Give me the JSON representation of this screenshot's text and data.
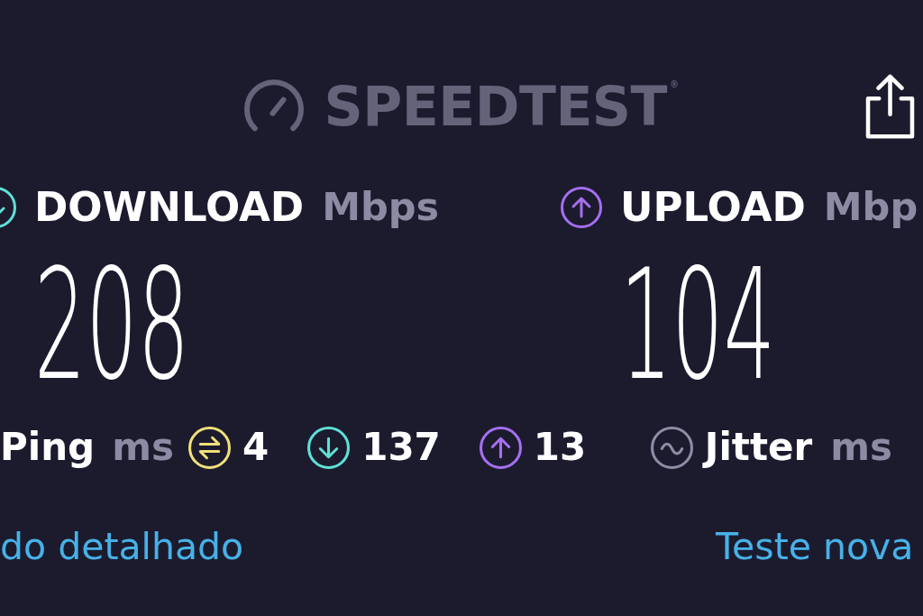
{
  "logo": "SPEEDTEST$^{®}$",
  "results": [
    {
      "kind": "download",
      "label": "DOWNLOAD",
      "unit": "Mbps",
      "value": "208"
    },
    {
      "kind": "upload",
      "label": "UPLOAD",
      "unit": "Mbp",
      "value": "104"
    }
  ],
  "ping": {
    "label": "Ping",
    "unit": "ms",
    "stats": [
      {
        "kind": "idle",
        "value": "4"
      },
      {
        "kind": "download",
        "value": "137"
      },
      {
        "kind": "upload",
        "value": "13"
      }
    ]
  },
  "jitter": {
    "label": "Jitter",
    "unit": "ms"
  },
  "links": [
    "do detalhado",
    "Teste nova"
  ]
}
